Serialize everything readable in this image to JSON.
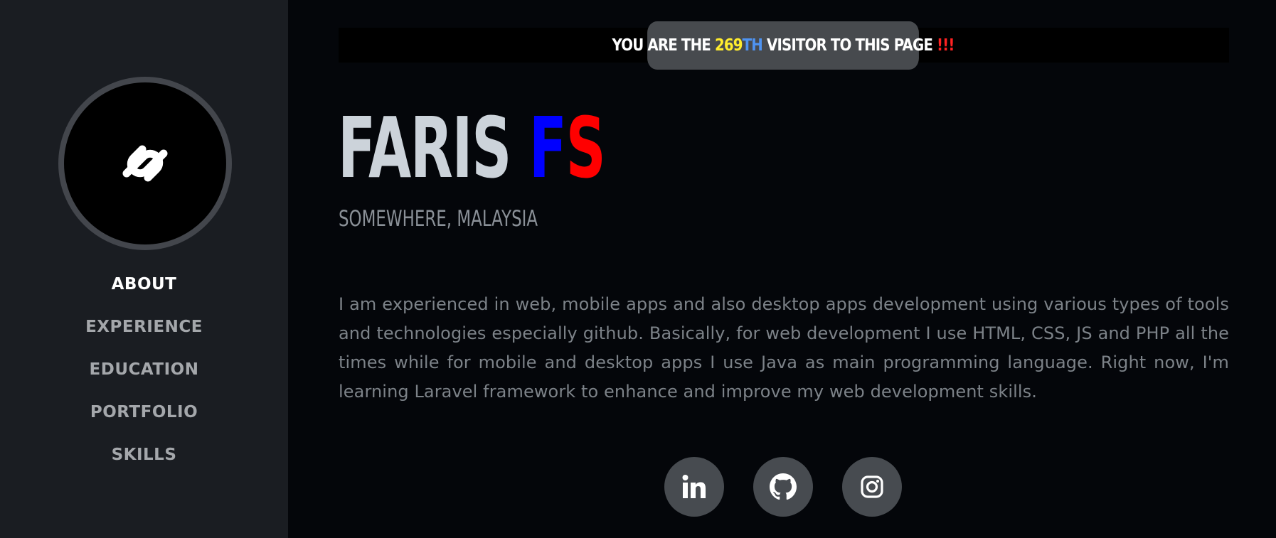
{
  "sidebar": {
    "avatar_icon": "logo-icon",
    "nav": [
      {
        "label": "ABOUT",
        "active": true
      },
      {
        "label": "EXPERIENCE",
        "active": false
      },
      {
        "label": "EDUCATION",
        "active": false
      },
      {
        "label": "PORTFOLIO",
        "active": false
      },
      {
        "label": "SKILLS",
        "active": false
      }
    ]
  },
  "visitor": {
    "prefix": "YOU ARE THE ",
    "count": "269",
    "suffix": "TH",
    "rest": " VISITOR TO THIS PAGE ",
    "bang": "!!!"
  },
  "profile": {
    "first_name": "FARIS ",
    "initial_f": "F",
    "initial_s": "S",
    "location": "SOMEWHERE, MALAYSIA",
    "bio": "I am experienced in web, mobile apps and also desktop apps development using various types of tools and technologies especially github. Basically, for web development I use HTML, CSS, JS and PHP all the times while for mobile and desktop apps I use Java as main programming language. Right now, I'm learning Laravel framework to enhance and improve my web development skills."
  },
  "social": [
    {
      "name": "linkedin-icon"
    },
    {
      "name": "github-icon"
    },
    {
      "name": "instagram-icon"
    }
  ],
  "colors": {
    "sidebar_bg": "#1a1d22",
    "main_bg": "#04060a",
    "accent_blue": "#0000ff",
    "accent_red": "#ff0000",
    "count_yellow": "#ffec2e"
  }
}
